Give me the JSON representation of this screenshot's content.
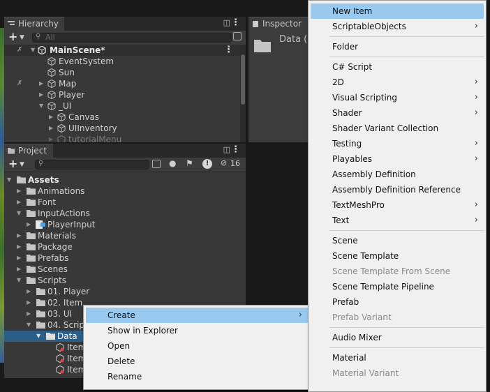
{
  "hierarchy": {
    "tab_title": "Hierarchy",
    "search_placeholder": "All",
    "items": [
      {
        "label": "MainScene*"
      },
      {
        "label": "EventSystem"
      },
      {
        "label": "Sun"
      },
      {
        "label": "Map"
      },
      {
        "label": "Player"
      },
      {
        "label": "_UI"
      },
      {
        "label": "Canvas"
      },
      {
        "label": "UIInventory"
      },
      {
        "label": "tutorialMenu"
      }
    ]
  },
  "inspector": {
    "tab_title": "Inspector",
    "asset_label": "Data (D"
  },
  "project": {
    "tab_title": "Project",
    "hidden_count": "16",
    "tree": [
      {
        "label": "Assets"
      },
      {
        "label": "Animations"
      },
      {
        "label": "Font"
      },
      {
        "label": "InputActions"
      },
      {
        "label": "PlayerInput"
      },
      {
        "label": "Materials"
      },
      {
        "label": "Package"
      },
      {
        "label": "Prefabs"
      },
      {
        "label": "Scenes"
      },
      {
        "label": "Scripts"
      },
      {
        "label": "01. Player"
      },
      {
        "label": "02. Item"
      },
      {
        "label": "03. UI"
      },
      {
        "label": "04. Scrip"
      },
      {
        "label": "Data"
      },
      {
        "label": "Item"
      },
      {
        "label": "Item"
      },
      {
        "label": "Item"
      }
    ]
  },
  "context_menu": {
    "items": [
      {
        "label": "Create"
      },
      {
        "label": "Show in Explorer"
      },
      {
        "label": "Open"
      },
      {
        "label": "Delete"
      },
      {
        "label": "Rename"
      }
    ]
  },
  "create_submenu": {
    "items": [
      {
        "label": "New Item"
      },
      {
        "label": "ScriptableObjects"
      },
      {
        "label": "Folder"
      },
      {
        "label": "C# Script"
      },
      {
        "label": "2D"
      },
      {
        "label": "Visual Scripting"
      },
      {
        "label": "Shader"
      },
      {
        "label": "Shader Variant Collection"
      },
      {
        "label": "Testing"
      },
      {
        "label": "Playables"
      },
      {
        "label": "Assembly Definition"
      },
      {
        "label": "Assembly Definition Reference"
      },
      {
        "label": "TextMeshPro"
      },
      {
        "label": "Text"
      },
      {
        "label": "Scene"
      },
      {
        "label": "Scene Template"
      },
      {
        "label": "Scene Template From Scene"
      },
      {
        "label": "Scene Template Pipeline"
      },
      {
        "label": "Prefab"
      },
      {
        "label": "Prefab Variant"
      },
      {
        "label": "Audio Mixer"
      },
      {
        "label": "Material"
      },
      {
        "label": "Material Variant"
      }
    ]
  },
  "colors": {
    "highlight": "#99c9ef",
    "selection": "#2c5d87",
    "panel": "#383838"
  }
}
